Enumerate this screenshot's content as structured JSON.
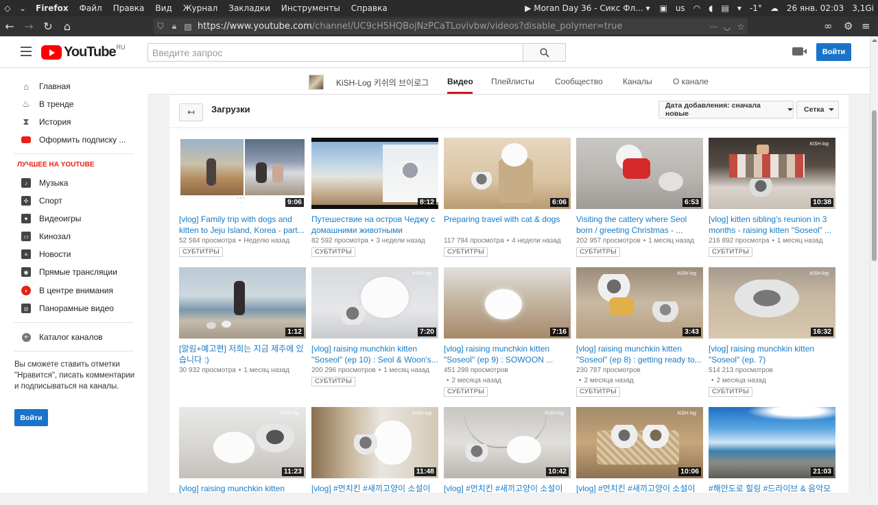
{
  "system_bar": {
    "app_name": "Firefox",
    "menus": [
      "Файл",
      "Правка",
      "Вид",
      "Журнал",
      "Закладки",
      "Инструменты",
      "Справка"
    ],
    "media_title": "Moran Day 36 - Сикс Фл...",
    "keyboard_layout": "us",
    "temperature": "-1°",
    "datetime": "26 янв. 02:03",
    "memory": "3,1Gi"
  },
  "browser": {
    "url_host": "https://www.youtube.com",
    "url_path": "/channel/UC9cH5HQBojNzPCaTLovivbw/videos?disable_polymer=true"
  },
  "header": {
    "logo_text": "YouTube",
    "region": "RU",
    "search_placeholder": "Введите запрос",
    "signin_label": "Войти"
  },
  "sidebar": {
    "main_items": [
      {
        "label": "Главная",
        "icon": "home-icon"
      },
      {
        "label": "В тренде",
        "icon": "flame-icon"
      },
      {
        "label": "История",
        "icon": "hourglass-icon"
      },
      {
        "label": "Оформить подписку ...",
        "icon": "youtube-red-icon"
      }
    ],
    "best_title": "ЛУЧШЕЕ НА YOUTUBE",
    "best_items": [
      {
        "label": "Музыка",
        "icon": "music-icon"
      },
      {
        "label": "Спорт",
        "icon": "sport-icon"
      },
      {
        "label": "Видеоигры",
        "icon": "gaming-icon"
      },
      {
        "label": "Кинозал",
        "icon": "movies-icon"
      },
      {
        "label": "Новости",
        "icon": "news-icon"
      },
      {
        "label": "Прямые трансляции",
        "icon": "live-icon"
      },
      {
        "label": "В центре внимания",
        "icon": "spotlight-icon"
      },
      {
        "label": "Панорамные видео",
        "icon": "360-icon"
      }
    ],
    "catalog_label": "Каталог каналов",
    "note": "Вы сможете ставить отметки \"Нравится\", писать комментарии и подписываться на каналы.",
    "signin_label": "Войти"
  },
  "channel": {
    "name": "KiSH-Log 키쉬의 브이로그",
    "tabs": [
      "Видео",
      "Плейлисты",
      "Сообщество",
      "Каналы",
      "О канале"
    ],
    "active_tab": "Видео"
  },
  "uploads": {
    "title": "Загрузки",
    "sort_label": "Дата добавления: сначала новые",
    "view_label": "Сетка",
    "videos": [
      {
        "title": "[vlog] Family trip with dogs and kitten to Jeju Island, Korea - part...",
        "views": "52 584 просмотра",
        "date": "Неделю назад",
        "duration": "9:06",
        "badge": "СУБТИТРЫ"
      },
      {
        "title": "Путешествие на остров Чеджу с домашними животными",
        "views": "82 592 просмотра",
        "date": "3 недели назад",
        "duration": "8:12",
        "badge": "СУБТИТРЫ"
      },
      {
        "title": "Preparing travel with cat & dogs",
        "views": "117 794 просмотра",
        "date": "4 недели назад",
        "duration": "6:06",
        "badge": "СУБТИТРЫ"
      },
      {
        "title": "Visiting the cattery where Seol born / greeting Christmas - ...",
        "views": "202 957 просмотров",
        "date": "1 месяц назад",
        "duration": "6:53",
        "badge": "СУБТИТРЫ"
      },
      {
        "title": "[vlog] kitten sibling's reunion in 3 months - raising kitten \"Soseol\" ...",
        "views": "216 892 просмотра",
        "date": "1 месяц назад",
        "duration": "10:38",
        "badge": "СУБТИТРЫ"
      },
      {
        "title": "[알림+예고편] 저희는 지금 제주에 있습니다 :)",
        "views": "30 932 просмотра",
        "date": "1 месяц назад",
        "duration": "1:12",
        "badge": ""
      },
      {
        "title": "[vlog] raising munchkin kitten \"Soseol\" (ep 10) : Seol & Woon's...",
        "views": "200 296 просмотров",
        "date": "1 месяц назад",
        "duration": "7:20",
        "badge": "СУБТИТРЫ"
      },
      {
        "title": "[vlog] raising munchkin kitten \"Soseol\" (ep 9) : SOWOON ...",
        "views": "451 298 просмотров",
        "date": "2 месяца назад",
        "duration": "7:16",
        "badge": "СУБТИТРЫ"
      },
      {
        "title": "[vlog] raising munchkin kitten \"Soseol\" (ep 8) : getting ready to...",
        "views": "230 787 просмотров",
        "date": "2 месяца назад",
        "duration": "3:43",
        "badge": "СУБТИТРЫ"
      },
      {
        "title": "[vlog] raising munchkin kitten \"Soseol\" (ep. 7)",
        "views": "514 213 просмотров",
        "date": "2 месяца назад",
        "duration": "16:32",
        "badge": "СУБТИТРЫ"
      },
      {
        "title": "[vlog] raising munchkin kitten",
        "views": "",
        "date": "",
        "duration": "11:23",
        "badge": ""
      },
      {
        "title": "[vlog] #먼치킨 #새끼고양이 소설이",
        "views": "",
        "date": "",
        "duration": "11:48",
        "badge": ""
      },
      {
        "title": "[vlog] #먼치킨 #새끼고양이 소설이",
        "views": "",
        "date": "",
        "duration": "10:42",
        "badge": ""
      },
      {
        "title": "[vlog] #먼치킨 #새끼고양이 소설이",
        "views": "",
        "date": "",
        "duration": "10:06",
        "badge": ""
      },
      {
        "title": "#해안도로 힐링 #드라이브 & 음악모",
        "views": "",
        "date": "",
        "duration": "21:03",
        "badge": ""
      }
    ]
  },
  "colors": {
    "accent_blue": "#167ac6",
    "button_blue": "#1a73c9",
    "youtube_red": "#ff0000",
    "tab_underline": "#cc181e"
  }
}
